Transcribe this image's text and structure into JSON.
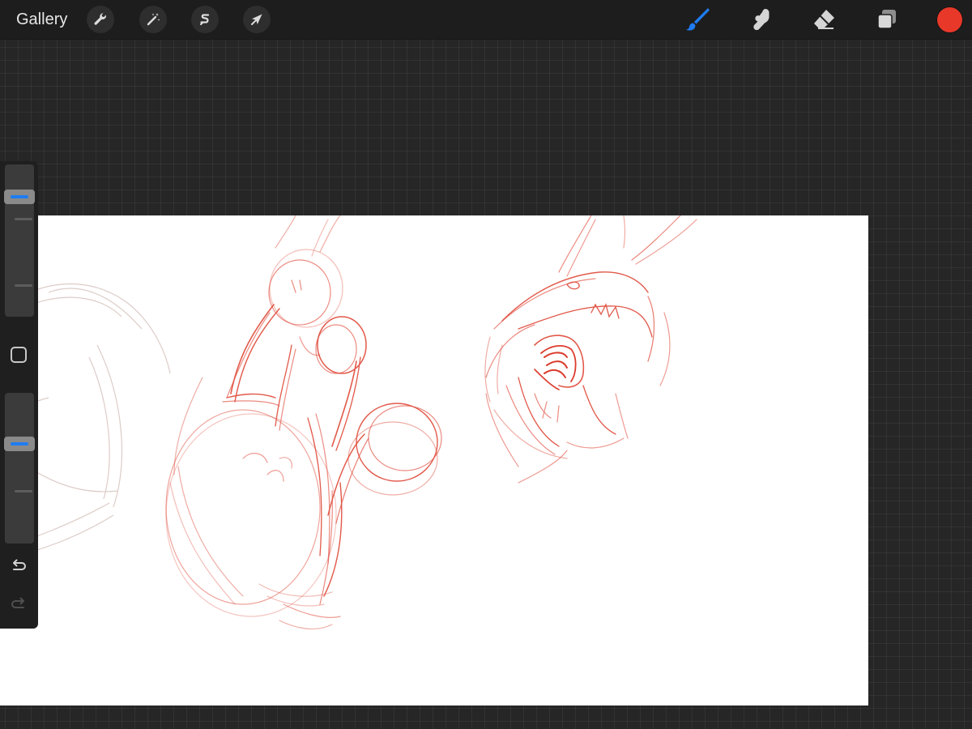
{
  "app": {
    "gallery_label": "Gallery"
  },
  "toolbar": {
    "left_actions": [
      {
        "name": "actions-button",
        "icon": "wrench-icon"
      },
      {
        "name": "adjustments-button",
        "icon": "magic-wand-icon"
      },
      {
        "name": "selection-button",
        "icon": "selection-s-icon"
      },
      {
        "name": "transform-button",
        "icon": "arrow-cursor-icon"
      }
    ],
    "right_tools": [
      {
        "name": "brush-tool",
        "icon": "brush-icon",
        "active": true
      },
      {
        "name": "smudge-tool",
        "icon": "smudge-finger-icon",
        "active": false
      },
      {
        "name": "eraser-tool",
        "icon": "eraser-icon",
        "active": false
      },
      {
        "name": "layers-button",
        "icon": "layers-icon",
        "active": false
      }
    ],
    "current_color": "#e8382a",
    "active_tool_color": "#1f7cf2"
  },
  "sidebar": {
    "brush_size_level": 0.82,
    "opacity_level": 0.68,
    "modify_button_icon": "square-icon",
    "undo_icon": "undo-icon",
    "redo_icon": "redo-icon"
  },
  "canvas": {
    "background": "#ffffff",
    "stroke_color": "#e15241",
    "faint_stroke_color": "#d9c9c4"
  }
}
